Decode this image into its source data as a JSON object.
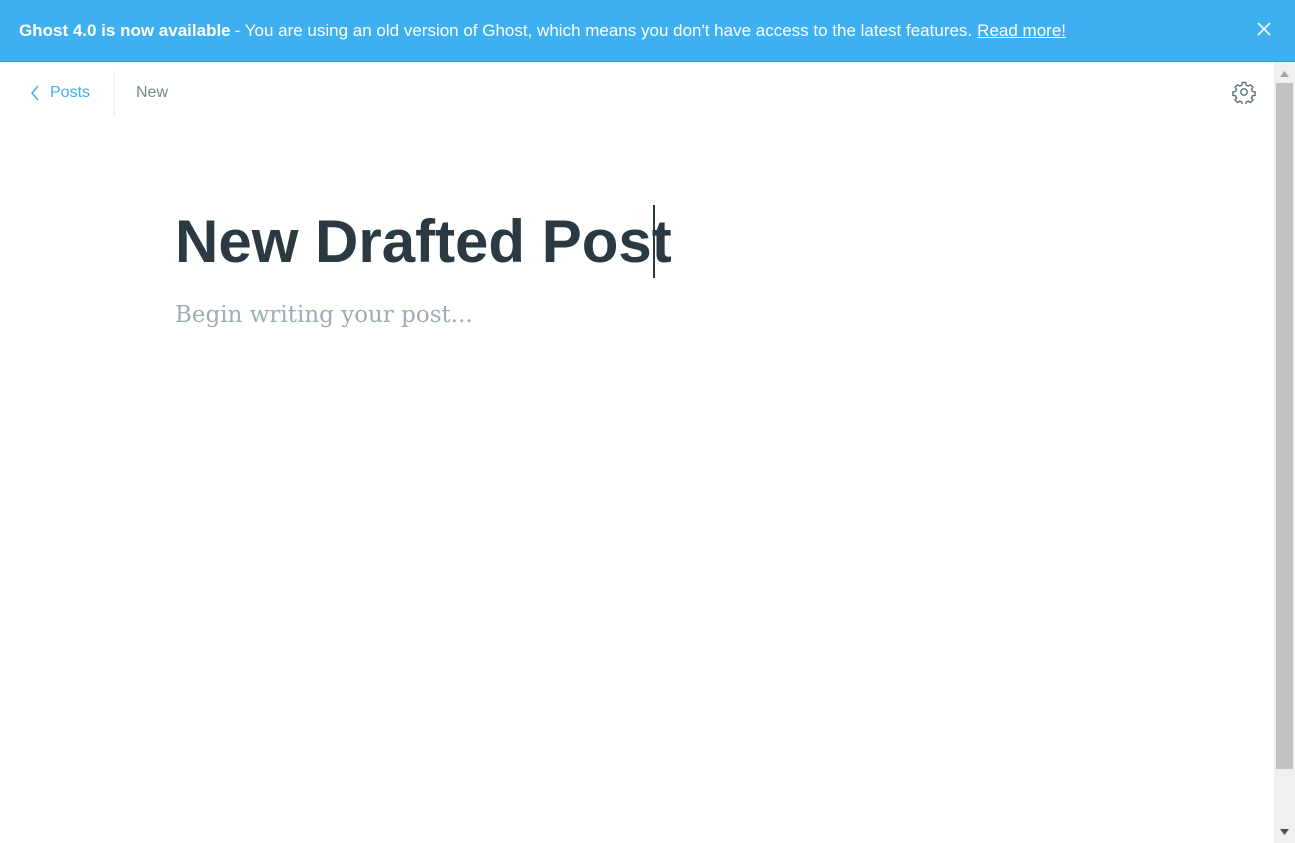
{
  "banner": {
    "headline": "Ghost 4.0 is now available",
    "message": " - You are using an old version of Ghost, which means you don't have access to the latest features.",
    "link_label": "Read more!",
    "background_color": "#3eb0ef",
    "close_icon": "close-icon"
  },
  "editor": {
    "back_label": "Posts",
    "back_icon": "chevron-left-icon",
    "status_label": "New",
    "settings_icon": "gear-icon",
    "title": "New Drafted Post",
    "body_placeholder": "Begin writing your post..."
  },
  "colors": {
    "accent": "#3eb0ef",
    "title_text": "#2b3a42",
    "placeholder_text": "#9badb6",
    "status_text": "#738a94"
  }
}
